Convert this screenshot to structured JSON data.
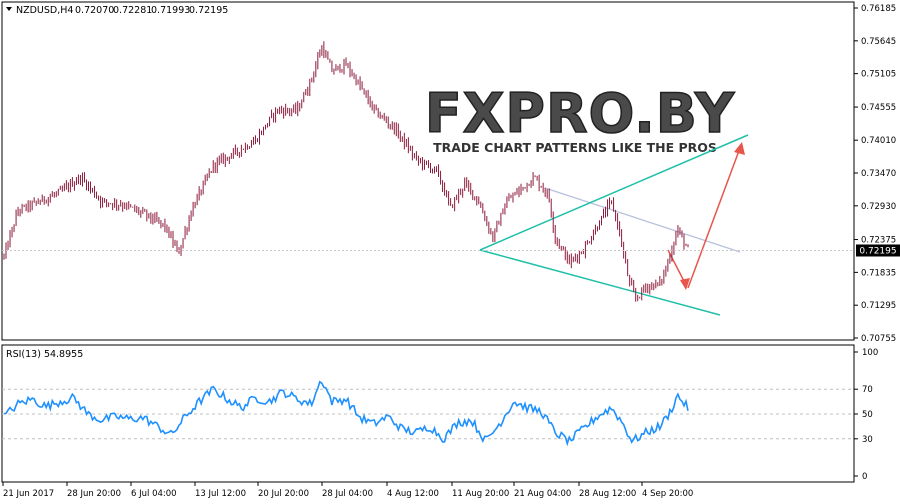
{
  "header": {
    "symbol": "NZDUSD,H4",
    "open": "0.72070",
    "high": "0.72281",
    "low": "0.71993",
    "close": "0.72195"
  },
  "watermark": {
    "logo_text": "FXPRO.BY",
    "tagline": "TRADE CHART PATTERNS LIKE THE PROS"
  },
  "rsi_panel": {
    "label": "RSI(13) 54.8955",
    "levels": [
      "100",
      "70",
      "50",
      "30",
      "0"
    ],
    "level_values": [
      100,
      70,
      50,
      30,
      0
    ]
  },
  "price_axis": {
    "ticks": [
      "0.76185",
      "0.75645",
      "0.75105",
      "0.74555",
      "0.74010",
      "0.73470",
      "0.72930",
      "0.72375",
      "0.71835",
      "0.71295",
      "0.70755"
    ],
    "tick_values": [
      0.76185,
      0.75645,
      0.75105,
      0.74555,
      0.7401,
      0.7347,
      0.7293,
      0.72375,
      0.71835,
      0.71295,
      0.70755
    ],
    "current_price": "0.72195"
  },
  "time_axis": {
    "labels": [
      "21 Jun 2017",
      "28 Jun 20:00",
      "6 Jul 04:00",
      "13 Jul 12:00",
      "20 Jul 20:00",
      "28 Jul 04:00",
      "4 Aug 12:00",
      "11 Aug 20:00",
      "21 Aug 04:00",
      "28 Aug 12:00",
      "4 Sep 20:00"
    ]
  },
  "colors": {
    "candle": "#8b1a3a",
    "rsi_line": "#1e90ff",
    "trendline": "#20c0a8",
    "resistance": "#b0b8d8",
    "arrow": "#e8554a",
    "grid": "#d8d8d8"
  },
  "chart_data": [
    {
      "type": "line",
      "name": "NZDUSD H4 price (bars)",
      "x": [
        "21 Jun 2017",
        "28 Jun 20:00",
        "6 Jul 04:00",
        "13 Jul 12:00",
        "20 Jul 20:00",
        "28 Jul 04:00",
        "4 Aug 12:00",
        "11 Aug 20:00",
        "21 Aug 04:00",
        "28 Aug 12:00",
        "4 Sep 20:00"
      ],
      "anchors": [
        {
          "t": 0,
          "price": 0.721
        },
        {
          "t": 2,
          "price": 0.7285
        },
        {
          "t": 5,
          "price": 0.73
        },
        {
          "t": 8,
          "price": 0.7315
        },
        {
          "t": 11,
          "price": 0.734
        },
        {
          "t": 14,
          "price": 0.73
        },
        {
          "t": 17,
          "price": 0.7295
        },
        {
          "t": 20,
          "price": 0.728
        },
        {
          "t": 23,
          "price": 0.726
        },
        {
          "t": 25,
          "price": 0.7215
        },
        {
          "t": 27,
          "price": 0.729
        },
        {
          "t": 30,
          "price": 0.736
        },
        {
          "t": 33,
          "price": 0.738
        },
        {
          "t": 36,
          "price": 0.74
        },
        {
          "t": 39,
          "price": 0.745
        },
        {
          "t": 42,
          "price": 0.745
        },
        {
          "t": 44,
          "price": 0.75
        },
        {
          "t": 45.5,
          "price": 0.7555
        },
        {
          "t": 47,
          "price": 0.7515
        },
        {
          "t": 49,
          "price": 0.7525
        },
        {
          "t": 51,
          "price": 0.749
        },
        {
          "t": 53,
          "price": 0.745
        },
        {
          "t": 56,
          "price": 0.742
        },
        {
          "t": 59,
          "price": 0.737
        },
        {
          "t": 62,
          "price": 0.735
        },
        {
          "t": 64,
          "price": 0.729
        },
        {
          "t": 66,
          "price": 0.733
        },
        {
          "t": 68,
          "price": 0.73
        },
        {
          "t": 70,
          "price": 0.724
        },
        {
          "t": 72,
          "price": 0.73
        },
        {
          "t": 74,
          "price": 0.732
        },
        {
          "t": 76,
          "price": 0.734
        },
        {
          "t": 78,
          "price": 0.731
        },
        {
          "t": 79,
          "price": 0.724
        },
        {
          "t": 81,
          "price": 0.72
        },
        {
          "t": 83,
          "price": 0.722
        },
        {
          "t": 85,
          "price": 0.726
        },
        {
          "t": 87,
          "price": 0.73
        },
        {
          "t": 88,
          "price": 0.726
        },
        {
          "t": 89.5,
          "price": 0.717
        },
        {
          "t": 90.5,
          "price": 0.714
        },
        {
          "t": 92,
          "price": 0.716
        },
        {
          "t": 94,
          "price": 0.7165
        },
        {
          "t": 95,
          "price": 0.7195
        },
        {
          "t": 96.5,
          "price": 0.7255
        },
        {
          "t": 98,
          "price": 0.722
        }
      ],
      "ylim": [
        0.70755,
        0.76185
      ]
    },
    {
      "type": "line",
      "name": "RSI(13)",
      "anchors": [
        {
          "t": 0,
          "rsi": 48
        },
        {
          "t": 2,
          "rsi": 58
        },
        {
          "t": 4,
          "rsi": 62
        },
        {
          "t": 6,
          "rsi": 56
        },
        {
          "t": 8,
          "rsi": 60
        },
        {
          "t": 10,
          "rsi": 63
        },
        {
          "t": 12,
          "rsi": 50
        },
        {
          "t": 14,
          "rsi": 45
        },
        {
          "t": 16,
          "rsi": 48
        },
        {
          "t": 18,
          "rsi": 46
        },
        {
          "t": 20,
          "rsi": 47
        },
        {
          "t": 22,
          "rsi": 40
        },
        {
          "t": 24,
          "rsi": 33
        },
        {
          "t": 26,
          "rsi": 48
        },
        {
          "t": 28,
          "rsi": 60
        },
        {
          "t": 30,
          "rsi": 70
        },
        {
          "t": 32,
          "rsi": 62
        },
        {
          "t": 34,
          "rsi": 55
        },
        {
          "t": 36,
          "rsi": 63
        },
        {
          "t": 38,
          "rsi": 60
        },
        {
          "t": 40,
          "rsi": 68
        },
        {
          "t": 42,
          "rsi": 62
        },
        {
          "t": 44,
          "rsi": 58
        },
        {
          "t": 45.5,
          "rsi": 78
        },
        {
          "t": 47,
          "rsi": 60
        },
        {
          "t": 49,
          "rsi": 62
        },
        {
          "t": 51,
          "rsi": 47
        },
        {
          "t": 53,
          "rsi": 42
        },
        {
          "t": 55,
          "rsi": 48
        },
        {
          "t": 57,
          "rsi": 38
        },
        {
          "t": 59,
          "rsi": 35
        },
        {
          "t": 61,
          "rsi": 40
        },
        {
          "t": 63,
          "rsi": 30
        },
        {
          "t": 65,
          "rsi": 43
        },
        {
          "t": 67,
          "rsi": 45
        },
        {
          "t": 69,
          "rsi": 28
        },
        {
          "t": 71,
          "rsi": 42
        },
        {
          "t": 73,
          "rsi": 60
        },
        {
          "t": 75,
          "rsi": 55
        },
        {
          "t": 77,
          "rsi": 52
        },
        {
          "t": 79,
          "rsi": 35
        },
        {
          "t": 81,
          "rsi": 28
        },
        {
          "t": 83,
          "rsi": 38
        },
        {
          "t": 85,
          "rsi": 48
        },
        {
          "t": 87,
          "rsi": 55
        },
        {
          "t": 88.5,
          "rsi": 44
        },
        {
          "t": 90,
          "rsi": 28
        },
        {
          "t": 92,
          "rsi": 35
        },
        {
          "t": 94,
          "rsi": 40
        },
        {
          "t": 95.5,
          "rsi": 52
        },
        {
          "t": 96.5,
          "rsi": 65
        },
        {
          "t": 98,
          "rsi": 54.9
        }
      ],
      "ylim": [
        0,
        100
      ]
    }
  ]
}
